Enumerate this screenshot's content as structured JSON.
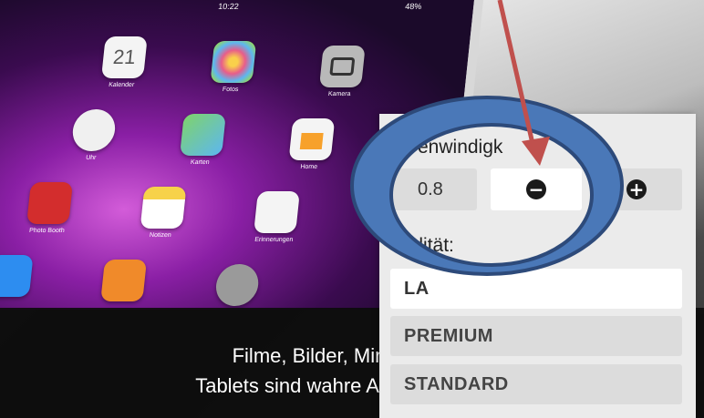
{
  "video": {
    "status_time": "10:22",
    "status_battery": "48%",
    "apps": [
      {
        "label": "Kalender",
        "day": "21",
        "color": "#f4f4f4"
      },
      {
        "label": "Fotos",
        "color": "#f8f8f8"
      },
      {
        "label": "Kamera",
        "color": "#b9b9b9"
      },
      {
        "label": "Uhr",
        "color": "#f0f0f0"
      },
      {
        "label": "Karten",
        "color": "#7fd36b"
      },
      {
        "label": "Home",
        "color": "#f7a12b"
      },
      {
        "label": "Photo Booth",
        "color": "#d32d2d"
      },
      {
        "label": "Notizen",
        "color": "#f7d24a"
      },
      {
        "label": "Erinnerungen",
        "color": "#f4f4f4"
      },
      {
        "label": "",
        "color": "#2d8df0"
      },
      {
        "label": "",
        "color": "#f08a2a"
      },
      {
        "label": "",
        "color": "#9a9a9a"
      }
    ],
    "caption_line1": "Filme, Bilder, Minibür",
    "caption_line2": "Tablets sind wahre Allesk"
  },
  "settings": {
    "speed_label": "enwindigk",
    "speed_value": "0.8",
    "minus_icon": "minus-circle-icon",
    "plus_icon": "plus-circle-icon",
    "quality_label": "ualität:",
    "quality_options": [
      "LA",
      "PREMIUM",
      "STANDARD"
    ]
  },
  "colors": {
    "annotation_ellipse_fill": "#4a78b8",
    "annotation_ellipse_border": "#2d4a7a",
    "annotation_arrow": "#c0504d"
  }
}
